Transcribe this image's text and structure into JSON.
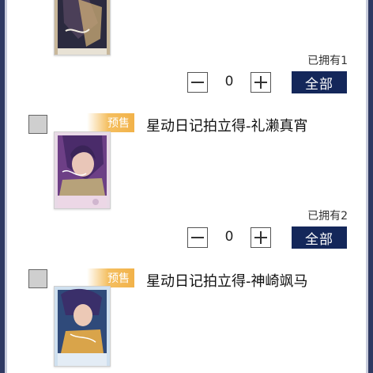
{
  "items": [
    {
      "owned": "已拥有1",
      "quantity": "0",
      "all_label": "全部"
    },
    {
      "badge": "预售",
      "title": "星动日记拍立得-礼濑真宵",
      "owned": "已拥有2",
      "quantity": "0",
      "all_label": "全部"
    },
    {
      "badge": "预售",
      "title": "星动日记拍立得-神崎飒马"
    }
  ],
  "colors": {
    "accent": "#14275a",
    "presale": "#f2b24a",
    "frame": "#2f3a63"
  }
}
